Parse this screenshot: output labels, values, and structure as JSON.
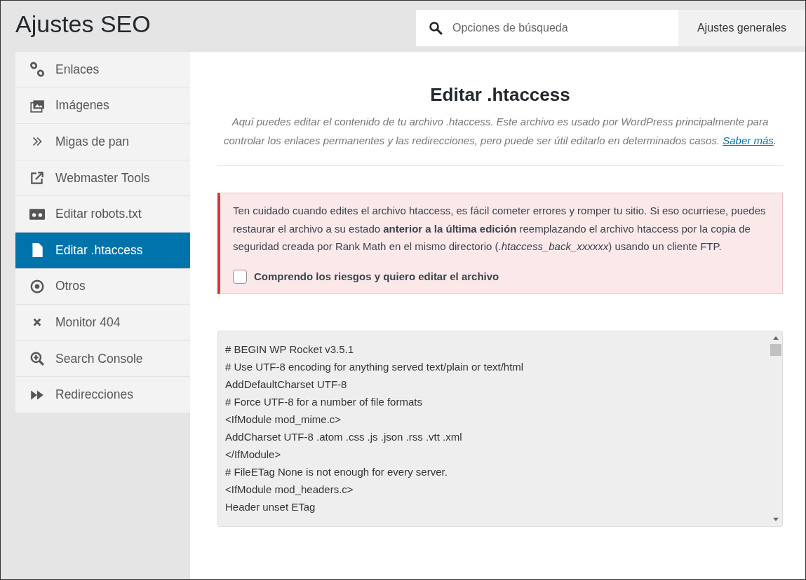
{
  "header": {
    "title": "Ajustes SEO",
    "search": {
      "placeholder": "Opciones de búsqueda"
    },
    "general_button": "Ajustes generales"
  },
  "sidebar": {
    "items": [
      {
        "label": "Enlaces",
        "selected": false
      },
      {
        "label": "Imágenes",
        "selected": false
      },
      {
        "label": "Migas de pan",
        "selected": false
      },
      {
        "label": "Webmaster Tools",
        "selected": false
      },
      {
        "label": "Editar robots.txt",
        "selected": false
      },
      {
        "label": "Editar .htaccess",
        "selected": true
      },
      {
        "label": "Otros",
        "selected": false
      },
      {
        "label": "Monitor 404",
        "selected": false
      },
      {
        "label": "Search Console",
        "selected": false
      },
      {
        "label": "Redirecciones",
        "selected": false
      }
    ]
  },
  "content": {
    "heading": "Editar .htaccess",
    "description": {
      "text": "Aquí puedes editar el contenido de tu archivo .htaccess. Este archivo es usado por WordPress principalmente para controlar los enlaces permanentes y las redirecciones, pero puede ser útil editarlo en determinados casos. ",
      "link": "Saber más",
      "after": "."
    },
    "notice": {
      "text": "Ten cuidado cuando edites el archivo htaccess, es fácil cometer errores y romper tu sitio. Si eso ocurriese, puedes restaurar el archivo a su estado **anterior a la última edición** reemplazando el archivo htaccess por la copia de seguridad creada por Rank Math en el mismo directorio (*.htaccess_back_xxxxxx*) usando un cliente FTP.",
      "checkbox": {
        "label": "Comprendo los riesgos y quiero editar el archivo",
        "checked": false
      }
    },
    "editor": {
      "lines": [
        "# BEGIN WP Rocket v3.5.1",
        "# Use UTF-8 encoding for anything served text/plain or text/html",
        "AddDefaultCharset UTF-8",
        "# Force UTF-8 for a number of file formats",
        "<IfModule mod_mime.c>",
        "AddCharset UTF-8 .atom .css .js .json .rss .vtt .xml",
        "</IfModule>",
        "# FileETag None is not enough for every server.",
        "<IfModule mod_headers.c>",
        "Header unset ETag"
      ]
    }
  }
}
